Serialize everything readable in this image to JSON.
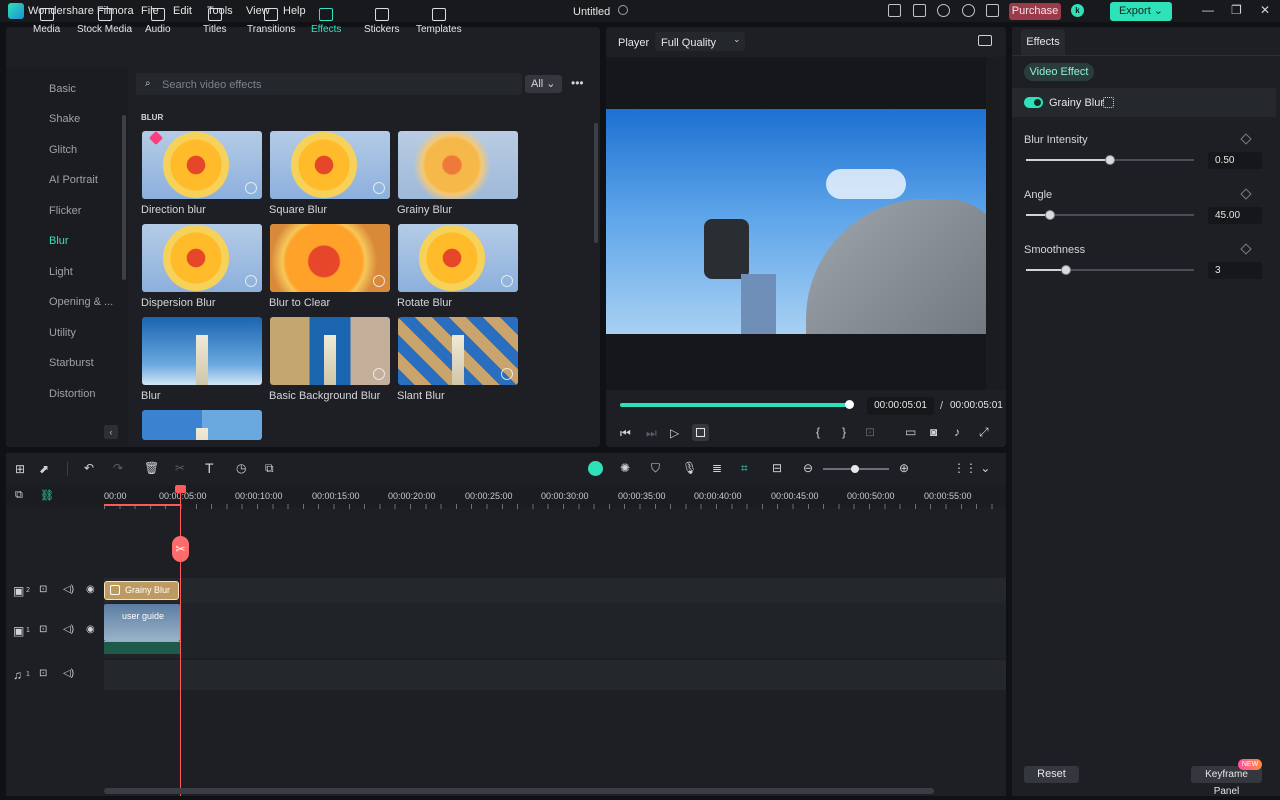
{
  "app": {
    "name": "Wondershare Filmora",
    "doc_title": "Untitled",
    "menu": [
      "File",
      "Edit",
      "Tools",
      "View",
      "Help"
    ],
    "purchase": "Purchase",
    "avatar": "k",
    "export": "Export"
  },
  "tools": [
    {
      "label": "Media"
    },
    {
      "label": "Stock Media"
    },
    {
      "label": "Audio"
    },
    {
      "label": "Titles"
    },
    {
      "label": "Transitions"
    },
    {
      "label": "Effects"
    },
    {
      "label": "Stickers"
    },
    {
      "label": "Templates"
    }
  ],
  "categories": [
    "Basic",
    "Shake",
    "Glitch",
    "AI Portrait",
    "Flicker",
    "Blur",
    "Light",
    "Opening & ...",
    "Utility",
    "Starburst",
    "Distortion"
  ],
  "search": {
    "placeholder": "Search video effects",
    "filter": "All"
  },
  "section": "BLUR",
  "effects": [
    "Direction blur",
    "Square Blur",
    "Grainy Blur",
    "Dispersion Blur",
    "Blur to Clear",
    "Rotate Blur",
    "Blur",
    "Basic Background Blur",
    "Slant Blur"
  ],
  "player": {
    "label": "Player",
    "quality": "Full Quality",
    "current": "00:00:05:01",
    "sep": "/",
    "total": "00:00:05:01",
    "progress": 1.0
  },
  "panel": {
    "tab": "Effects",
    "chip": "Video Effect",
    "effect_name": "Grainy Blur",
    "params": [
      {
        "label": "Blur Intensity",
        "value": "0.50",
        "fraction": 0.5
      },
      {
        "label": "Angle",
        "value": "45.00",
        "fraction": 0.14
      },
      {
        "label": "Smoothness",
        "value": "3",
        "fraction": 0.24
      }
    ],
    "reset": "Reset",
    "keyframe": "Keyframe Panel",
    "new": "NEW"
  },
  "timeline": {
    "ruler": [
      "00:00",
      "00:00:05:00",
      "00:00:10:00",
      "00:00:15:00",
      "00:00:20:00",
      "00:00:25:00",
      "00:00:30:00",
      "00:00:35:00",
      "00:00:40:00",
      "00:00:45:00",
      "00:00:50:00",
      "00:00:55:00"
    ],
    "tracks": [
      "2",
      "1",
      "1"
    ],
    "effect_clip": "Grainy Blur",
    "video_clip": "user guide"
  },
  "colors": {
    "accent": "#2ee1b8",
    "purchase": "#9b3a49",
    "playhead": "#ff5a5a"
  }
}
